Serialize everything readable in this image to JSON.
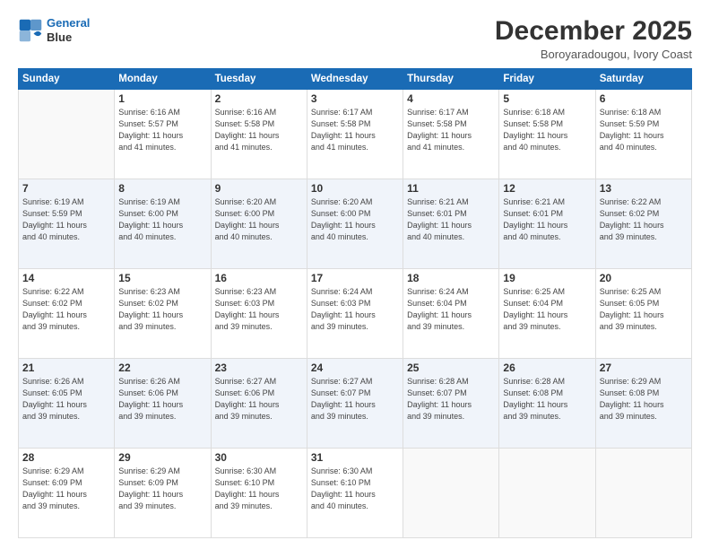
{
  "logo": {
    "line1": "General",
    "line2": "Blue"
  },
  "title": "December 2025",
  "location": "Boroyaradougou, Ivory Coast",
  "days_of_week": [
    "Sunday",
    "Monday",
    "Tuesday",
    "Wednesday",
    "Thursday",
    "Friday",
    "Saturday"
  ],
  "weeks": [
    [
      {
        "day": "",
        "info": ""
      },
      {
        "day": "1",
        "info": "Sunrise: 6:16 AM\nSunset: 5:57 PM\nDaylight: 11 hours\nand 41 minutes."
      },
      {
        "day": "2",
        "info": "Sunrise: 6:16 AM\nSunset: 5:58 PM\nDaylight: 11 hours\nand 41 minutes."
      },
      {
        "day": "3",
        "info": "Sunrise: 6:17 AM\nSunset: 5:58 PM\nDaylight: 11 hours\nand 41 minutes."
      },
      {
        "day": "4",
        "info": "Sunrise: 6:17 AM\nSunset: 5:58 PM\nDaylight: 11 hours\nand 41 minutes."
      },
      {
        "day": "5",
        "info": "Sunrise: 6:18 AM\nSunset: 5:58 PM\nDaylight: 11 hours\nand 40 minutes."
      },
      {
        "day": "6",
        "info": "Sunrise: 6:18 AM\nSunset: 5:59 PM\nDaylight: 11 hours\nand 40 minutes."
      }
    ],
    [
      {
        "day": "7",
        "info": "Sunrise: 6:19 AM\nSunset: 5:59 PM\nDaylight: 11 hours\nand 40 minutes."
      },
      {
        "day": "8",
        "info": "Sunrise: 6:19 AM\nSunset: 6:00 PM\nDaylight: 11 hours\nand 40 minutes."
      },
      {
        "day": "9",
        "info": "Sunrise: 6:20 AM\nSunset: 6:00 PM\nDaylight: 11 hours\nand 40 minutes."
      },
      {
        "day": "10",
        "info": "Sunrise: 6:20 AM\nSunset: 6:00 PM\nDaylight: 11 hours\nand 40 minutes."
      },
      {
        "day": "11",
        "info": "Sunrise: 6:21 AM\nSunset: 6:01 PM\nDaylight: 11 hours\nand 40 minutes."
      },
      {
        "day": "12",
        "info": "Sunrise: 6:21 AM\nSunset: 6:01 PM\nDaylight: 11 hours\nand 40 minutes."
      },
      {
        "day": "13",
        "info": "Sunrise: 6:22 AM\nSunset: 6:02 PM\nDaylight: 11 hours\nand 39 minutes."
      }
    ],
    [
      {
        "day": "14",
        "info": "Sunrise: 6:22 AM\nSunset: 6:02 PM\nDaylight: 11 hours\nand 39 minutes."
      },
      {
        "day": "15",
        "info": "Sunrise: 6:23 AM\nSunset: 6:02 PM\nDaylight: 11 hours\nand 39 minutes."
      },
      {
        "day": "16",
        "info": "Sunrise: 6:23 AM\nSunset: 6:03 PM\nDaylight: 11 hours\nand 39 minutes."
      },
      {
        "day": "17",
        "info": "Sunrise: 6:24 AM\nSunset: 6:03 PM\nDaylight: 11 hours\nand 39 minutes."
      },
      {
        "day": "18",
        "info": "Sunrise: 6:24 AM\nSunset: 6:04 PM\nDaylight: 11 hours\nand 39 minutes."
      },
      {
        "day": "19",
        "info": "Sunrise: 6:25 AM\nSunset: 6:04 PM\nDaylight: 11 hours\nand 39 minutes."
      },
      {
        "day": "20",
        "info": "Sunrise: 6:25 AM\nSunset: 6:05 PM\nDaylight: 11 hours\nand 39 minutes."
      }
    ],
    [
      {
        "day": "21",
        "info": "Sunrise: 6:26 AM\nSunset: 6:05 PM\nDaylight: 11 hours\nand 39 minutes."
      },
      {
        "day": "22",
        "info": "Sunrise: 6:26 AM\nSunset: 6:06 PM\nDaylight: 11 hours\nand 39 minutes."
      },
      {
        "day": "23",
        "info": "Sunrise: 6:27 AM\nSunset: 6:06 PM\nDaylight: 11 hours\nand 39 minutes."
      },
      {
        "day": "24",
        "info": "Sunrise: 6:27 AM\nSunset: 6:07 PM\nDaylight: 11 hours\nand 39 minutes."
      },
      {
        "day": "25",
        "info": "Sunrise: 6:28 AM\nSunset: 6:07 PM\nDaylight: 11 hours\nand 39 minutes."
      },
      {
        "day": "26",
        "info": "Sunrise: 6:28 AM\nSunset: 6:08 PM\nDaylight: 11 hours\nand 39 minutes."
      },
      {
        "day": "27",
        "info": "Sunrise: 6:29 AM\nSunset: 6:08 PM\nDaylight: 11 hours\nand 39 minutes."
      }
    ],
    [
      {
        "day": "28",
        "info": "Sunrise: 6:29 AM\nSunset: 6:09 PM\nDaylight: 11 hours\nand 39 minutes."
      },
      {
        "day": "29",
        "info": "Sunrise: 6:29 AM\nSunset: 6:09 PM\nDaylight: 11 hours\nand 39 minutes."
      },
      {
        "day": "30",
        "info": "Sunrise: 6:30 AM\nSunset: 6:10 PM\nDaylight: 11 hours\nand 39 minutes."
      },
      {
        "day": "31",
        "info": "Sunrise: 6:30 AM\nSunset: 6:10 PM\nDaylight: 11 hours\nand 40 minutes."
      },
      {
        "day": "",
        "info": ""
      },
      {
        "day": "",
        "info": ""
      },
      {
        "day": "",
        "info": ""
      }
    ]
  ]
}
